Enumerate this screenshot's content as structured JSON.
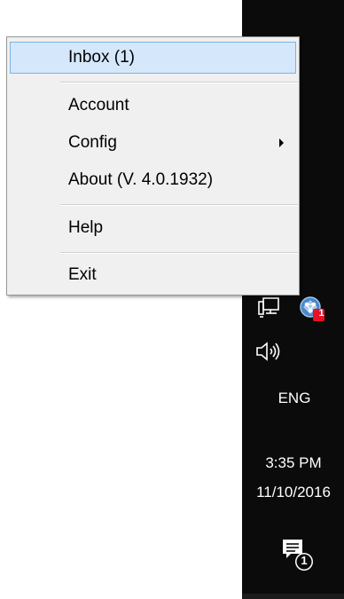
{
  "menu": {
    "items": [
      {
        "label": "Inbox (1)",
        "highlighted": true
      },
      {
        "label": "Account"
      },
      {
        "label": "Config",
        "has_submenu": true
      },
      {
        "label": "About (V. 4.0.1932)"
      },
      {
        "label": "Help"
      },
      {
        "label": "Exit"
      }
    ]
  },
  "tray": {
    "network_icon": "network-icon",
    "app_icon": "app-notification-icon",
    "app_badge": "1",
    "volume_icon": "volume-icon",
    "language": "ENG",
    "time": "3:35 PM",
    "date": "11/10/2016",
    "notification_icon": "action-center-icon",
    "notification_badge": "1"
  },
  "colors": {
    "taskbar": "#0b0b0b",
    "menu_bg": "#f0f0f0",
    "highlight_bg": "#d5e8fb",
    "highlight_border": "#7db2e6",
    "badge_red": "#e81123"
  }
}
